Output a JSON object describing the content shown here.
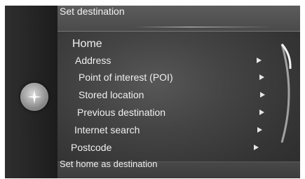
{
  "header": {
    "title": "Set destination"
  },
  "controller": {
    "icon": "navigation-compass-icon"
  },
  "menu": {
    "items": [
      {
        "label": "Home",
        "selected": true,
        "has_submenu": false
      },
      {
        "label": "Address",
        "selected": false,
        "has_submenu": true
      },
      {
        "label": "Point of interest (POI)",
        "selected": false,
        "has_submenu": true
      },
      {
        "label": "Stored location",
        "selected": false,
        "has_submenu": true
      },
      {
        "label": "Previous destination",
        "selected": false,
        "has_submenu": true
      },
      {
        "label": "Internet search",
        "selected": false,
        "has_submenu": true
      },
      {
        "label": "Postcode",
        "selected": false,
        "has_submenu": true
      }
    ]
  },
  "footer": {
    "hint": "Set home as destination"
  },
  "colors": {
    "screen_background": "#2b2b2b",
    "text": "#f0f0f0"
  }
}
